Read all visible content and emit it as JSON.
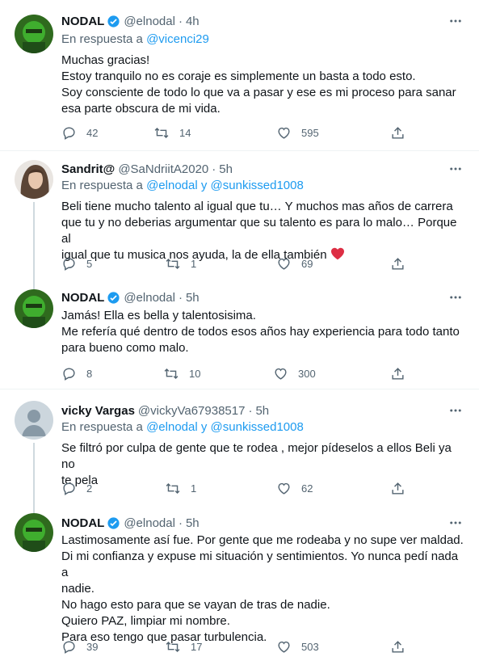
{
  "reply_prefix": "En respuesta a",
  "reply_conj": "y",
  "tweets": [
    {
      "name": "NODAL",
      "handle": "@elnodal",
      "time": "4h",
      "verified": true,
      "reply_to": [
        "@vicenci29"
      ],
      "lines": [
        "Muchas gracias!",
        "Estoy tranquilo no es coraje es simplemente un basta a todo esto.",
        "Soy consciente de todo lo que va a pasar y ese es mi proceso para sanar",
        "esa parte obscura de mi vida."
      ],
      "replies": "42",
      "retweets": "14",
      "likes": "595"
    },
    {
      "name": "Sandrit@",
      "handle": "@SaNdriitA2020",
      "time": "5h",
      "verified": false,
      "reply_to": [
        "@elnodal",
        "@sunkissed1008"
      ],
      "lines": [
        "Beli tiene mucho talento al igual que tu… Y muchos mas años de carrera",
        "que tu y no deberias argumentar que su talento es para lo malo… Porque al",
        "igual que tu musica nos ayuda, la de ella también"
      ],
      "emoji": "heart",
      "replies": "5",
      "retweets": "1",
      "likes": "69"
    },
    {
      "name": "NODAL",
      "handle": "@elnodal",
      "time": "5h",
      "verified": true,
      "reply_to": [],
      "lines": [
        "Jamás! Ella es bella y talentosisima.",
        "Me refería qué dentro de todos esos años hay experiencia para todo tanto",
        "para bueno como malo."
      ],
      "replies": "8",
      "retweets": "10",
      "likes": "300"
    },
    {
      "name": "vicky Vargas",
      "handle": "@vickyVa67938517",
      "time": "5h",
      "verified": false,
      "reply_to": [
        "@elnodal",
        "@sunkissed1008"
      ],
      "lines": [
        "Se filtró por culpa de gente que te rodea , mejor pídeselos a ellos Beli ya no",
        "te pela"
      ],
      "replies": "2",
      "retweets": "1",
      "likes": "62"
    },
    {
      "name": "NODAL",
      "handle": "@elnodal",
      "time": "5h",
      "verified": true,
      "reply_to": [],
      "lines": [
        "Lastimosamente así fue. Por gente que me rodeaba y no supe ver maldad.",
        "Di mi confianza y expuse mi situación y sentimientos. Yo nunca pedí nada a",
        "nadie.",
        "No hago esto para que se vayan de tras de nadie.",
        "Quiero PAZ, limpiar mi nombre.",
        "Para eso tengo que pasar turbulencia."
      ],
      "replies": "39",
      "retweets": "17",
      "likes": "503"
    }
  ],
  "colors": {
    "accent": "#1d9bf0",
    "muted": "#536471",
    "text": "#0f1419",
    "heart": "#f91880"
  },
  "icons": [
    "verified-badge-icon",
    "more-icon",
    "reply-icon",
    "retweet-icon",
    "like-icon",
    "share-icon"
  ]
}
